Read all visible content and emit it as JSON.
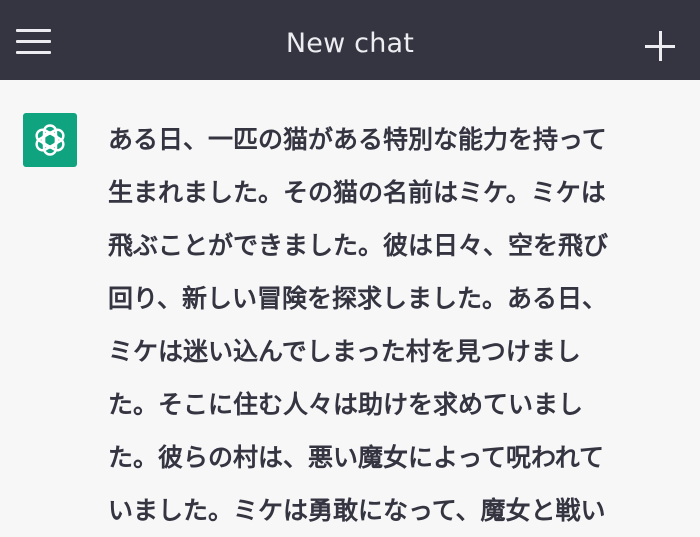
{
  "header": {
    "title": "New chat",
    "menu_icon": "hamburger-menu-icon",
    "new_chat_icon": "plus-icon"
  },
  "message": {
    "avatar_icon": "openai-logo-icon",
    "avatar_color": "#10a37f",
    "text": "ある日、一匹の猫がある特別な能力を持って\n生まれました。その猫の名前はミケ。ミケは\n飛ぶことができました。彼は日々、空を飛び\n回り、新しい冒険を探求しました。ある日、\nミケは迷い込んでしまった村を見つけまし\nた。そこに住む人々は助けを求めていまし\nた。彼らの村は、悪い魔女によって呪われて\nいました。ミケは勇敢になって、魔女と戦い"
  },
  "colors": {
    "header_bg": "#343541",
    "page_bg": "#f7f7f8",
    "text": "#343541"
  }
}
